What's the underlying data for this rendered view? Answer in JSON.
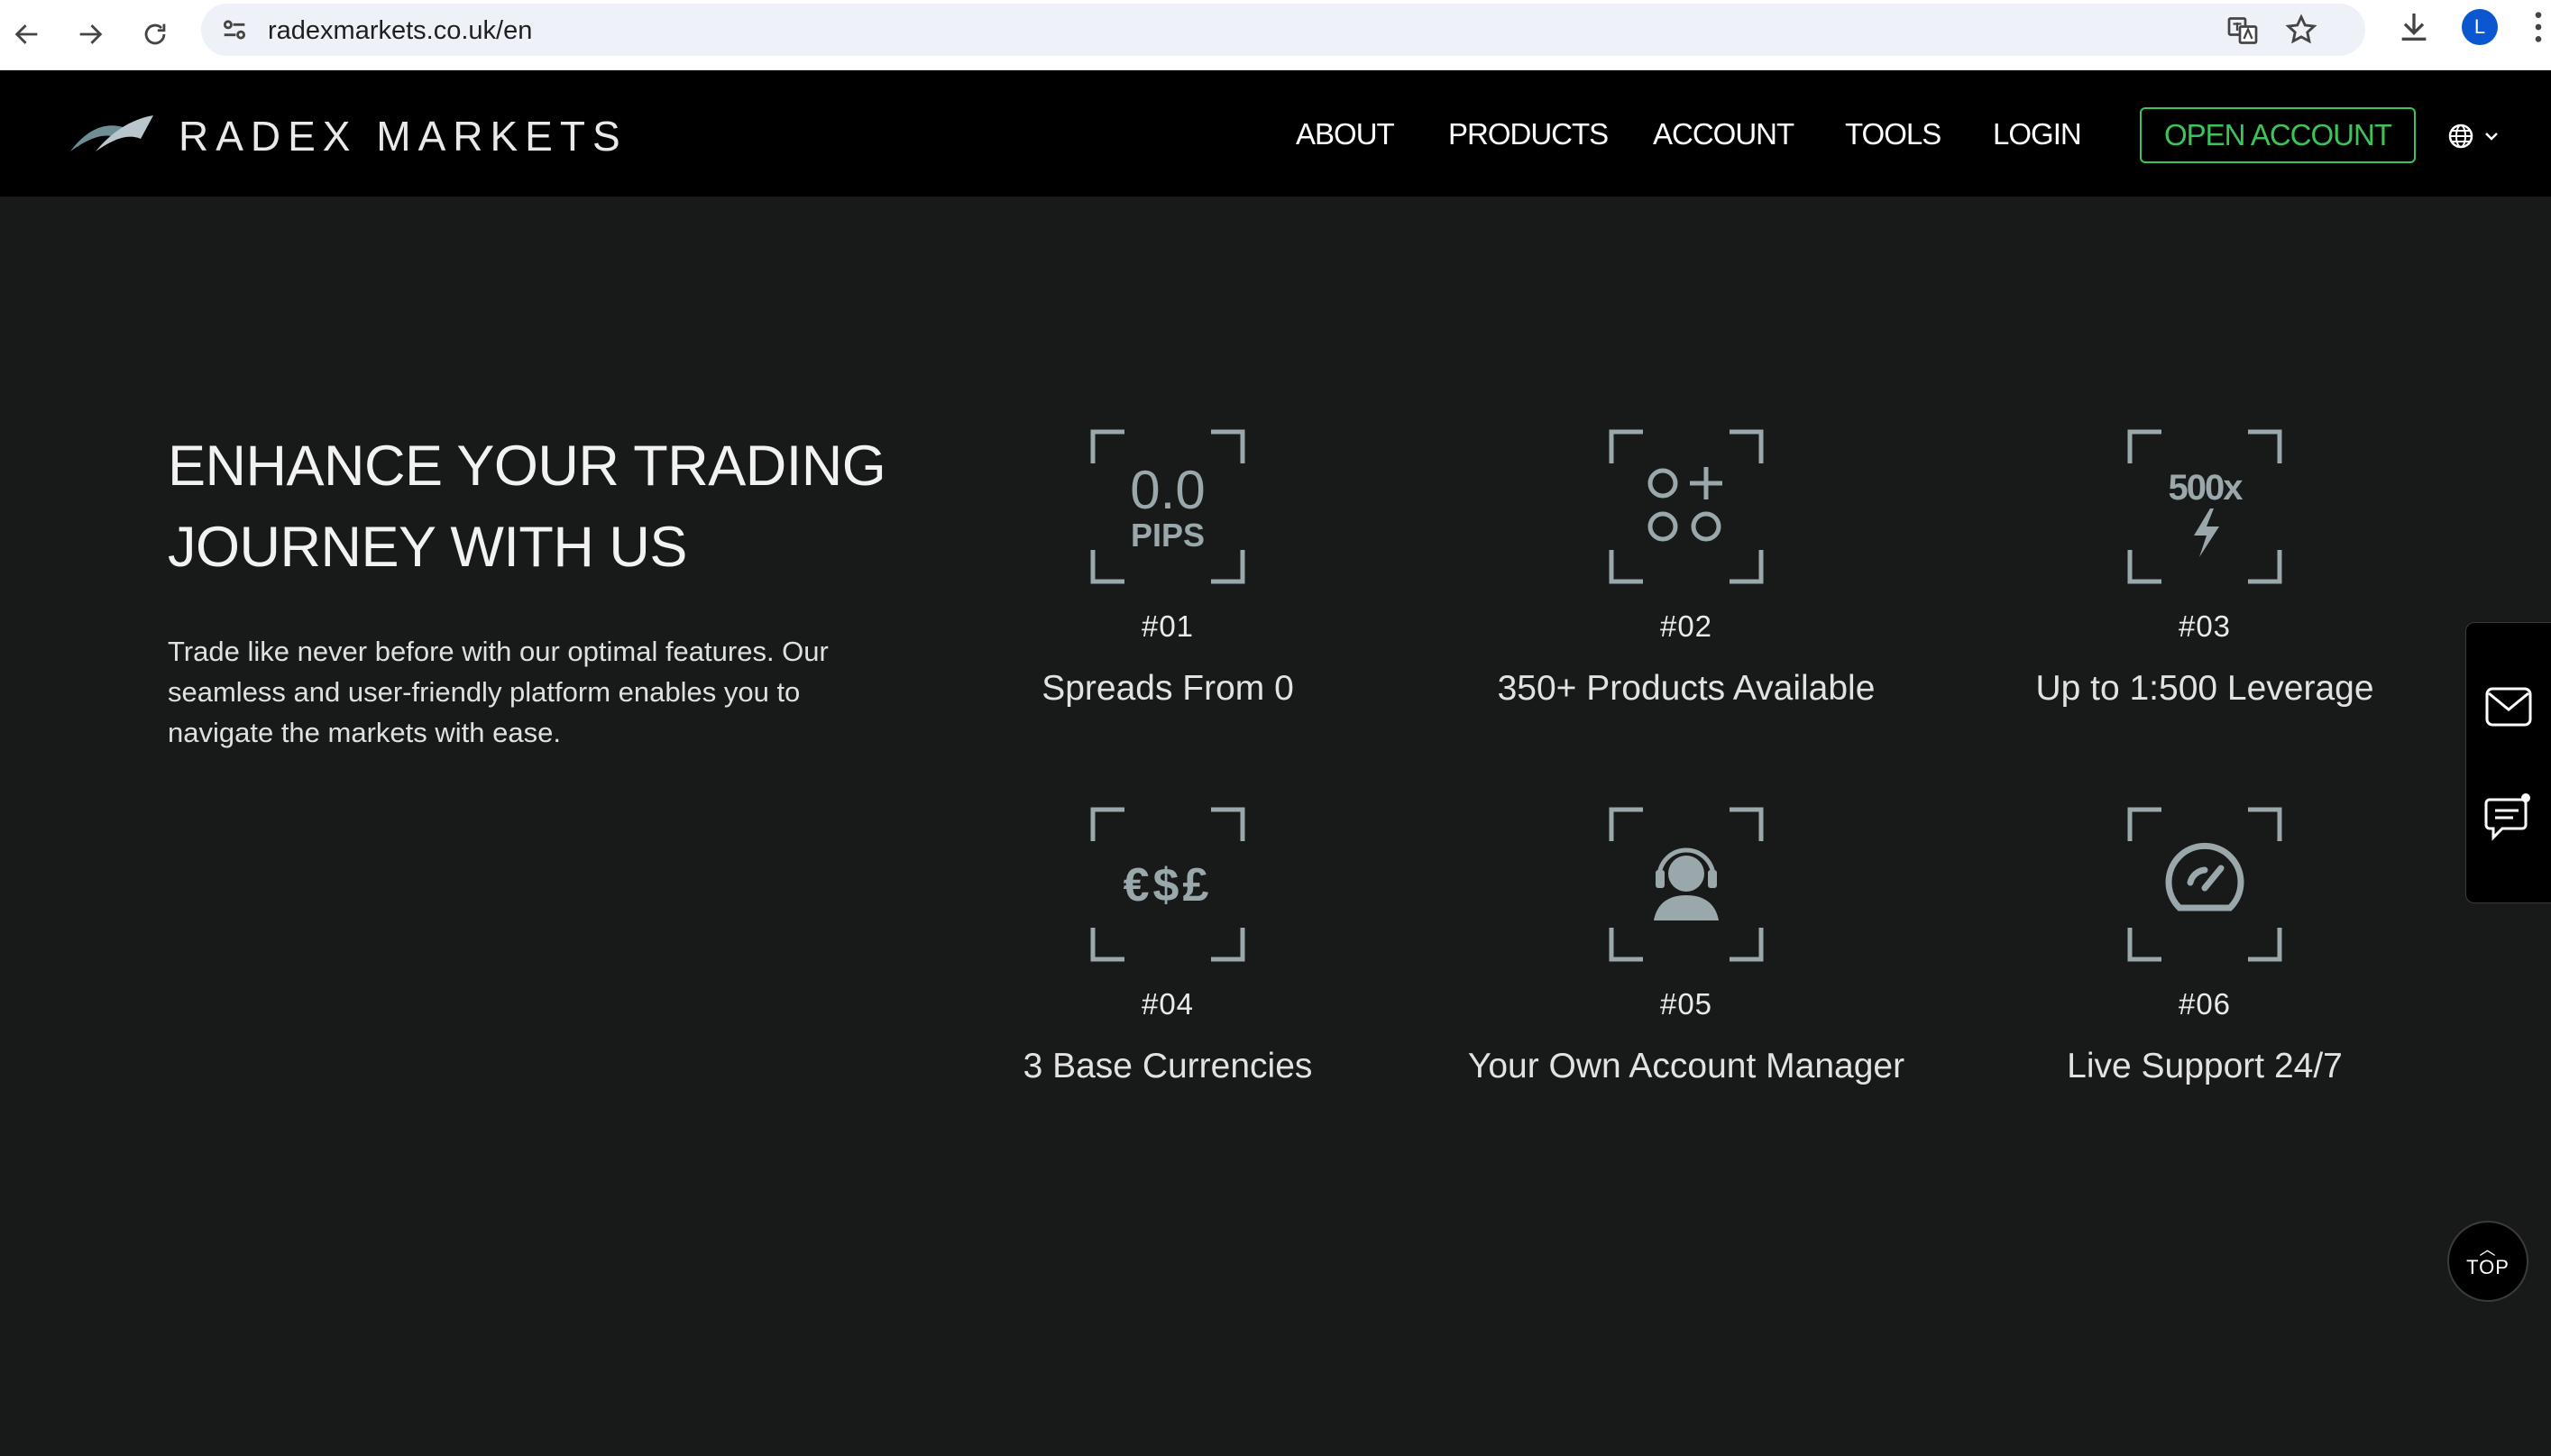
{
  "browser": {
    "url": "radexmarkets.co.uk/en",
    "avatar_letter": "L"
  },
  "header": {
    "brand": "RADEX MARKETS",
    "menu": [
      "ABOUT",
      "PRODUCTS",
      "ACCOUNT",
      "TOOLS",
      "LOGIN"
    ],
    "cta": "OPEN ACCOUNT",
    "accent_color": "#3cc45a"
  },
  "hero": {
    "title_line1": "ENHANCE YOUR TRADING",
    "title_line2": "JOURNEY WITH US",
    "description": "Trade like never before with our optimal features. Our seamless and user-friendly platform enables you to navigate the markets with ease."
  },
  "features": [
    {
      "num": "#01",
      "label": "Spreads From 0",
      "icon": "pips-icon",
      "icon_text_1": "0.0",
      "icon_text_2": "PIPS"
    },
    {
      "num": "#02",
      "label": "350+ Products Available",
      "icon": "products-icon"
    },
    {
      "num": "#03",
      "label": "Up to 1:500 Leverage",
      "icon": "leverage-icon",
      "icon_text_1": "500x"
    },
    {
      "num": "#04",
      "label": "3 Base Currencies",
      "icon": "currencies-icon",
      "icon_text_1": "€$£"
    },
    {
      "num": "#05",
      "label": "Your Own Account Manager",
      "icon": "account-manager-icon"
    },
    {
      "num": "#06",
      "label": "Live Support 24/7",
      "icon": "speedometer-icon"
    }
  ],
  "widgets": {
    "top_label": "TOP"
  }
}
